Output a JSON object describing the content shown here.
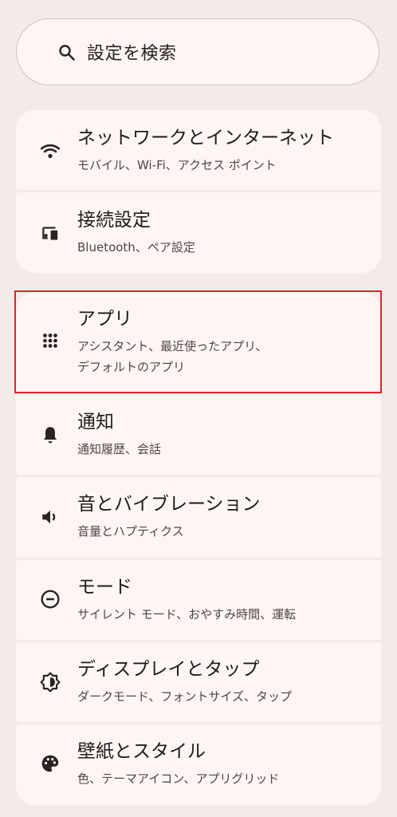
{
  "search": {
    "label": "設定を検索",
    "icon": "search-icon"
  },
  "groups": [
    {
      "items": [
        {
          "id": "network",
          "icon": "wifi-icon",
          "title": "ネットワークとインターネット",
          "subtitle": [
            "モバイル、Wi-Fi、アクセス ポイント"
          ]
        },
        {
          "id": "connected-devices",
          "icon": "devices-icon",
          "title": "接続設定",
          "subtitle": [
            "Bluetooth、ペア設定"
          ]
        }
      ]
    },
    {
      "items": [
        {
          "id": "apps",
          "icon": "apps-grid-icon",
          "title": "アプリ",
          "subtitle": [
            "アシスタント、最近使ったアプリ、",
            "デフォルトのアプリ"
          ],
          "highlighted": true
        },
        {
          "id": "notifications",
          "icon": "bell-icon",
          "title": "通知",
          "subtitle": [
            "通知履歴、会話"
          ]
        },
        {
          "id": "sound",
          "icon": "speaker-icon",
          "title": "音とバイブレーション",
          "subtitle": [
            "音量とハプティクス"
          ]
        },
        {
          "id": "modes",
          "icon": "minus-circle-icon",
          "title": "モード",
          "subtitle": [
            "サイレント モード、おやすみ時間、運転"
          ]
        },
        {
          "id": "display",
          "icon": "brightness-icon",
          "title": "ディスプレイとタップ",
          "subtitle": [
            "ダークモード、フォントサイズ、タップ"
          ]
        },
        {
          "id": "wallpaper",
          "icon": "palette-icon",
          "title": "壁紙とスタイル",
          "subtitle": [
            "色、テーマアイコン、アプリグリッド"
          ]
        }
      ]
    }
  ],
  "colors": {
    "background": "#f4ebe8",
    "card": "#fdf6f4",
    "highlight_border": "#e3202e"
  }
}
